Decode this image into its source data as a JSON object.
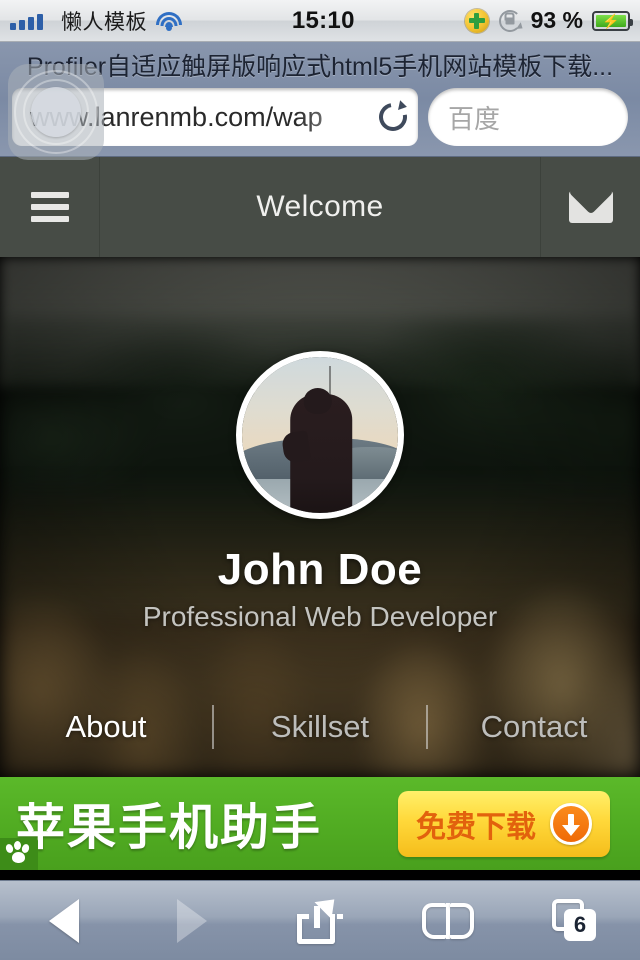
{
  "status_bar": {
    "carrier": "懒人模板",
    "signal_icon": "signal-bars-icon",
    "wifi_icon": "wifi-icon",
    "time": "15:10",
    "plus_icon": "green-plus-circle-icon",
    "rotation_lock_icon": "rotation-lock-icon",
    "battery_percent": "93 %",
    "battery_icon": "battery-charging-icon",
    "signal_bars_filled": 4,
    "signal_bars_total": 5
  },
  "assistive_touch": {
    "name": "assistive-touch-button"
  },
  "browser": {
    "page_title": "Profiler自适应触屏版响应式html5手机网站模板下载...",
    "url": "www.lanrenmb.com/wap",
    "reload_icon": "reload-icon",
    "search_placeholder": "百度"
  },
  "site_header": {
    "menu_icon": "hamburger-menu-icon",
    "title": "Welcome",
    "mail_icon": "envelope-icon"
  },
  "hero": {
    "avatar_alt": "profile-photo",
    "name": "John Doe",
    "tagline": "Professional Web Developer",
    "nav": [
      {
        "label": "About",
        "active": true
      },
      {
        "label": "Skillset",
        "active": false
      },
      {
        "label": "Contact",
        "active": false
      }
    ]
  },
  "ad": {
    "headline": "苹果手机助手",
    "button_label": "免费下载",
    "download_icon": "download-circle-icon",
    "provider_icon": "baidu-paw-icon",
    "bg_color": "#52ad23",
    "button_color": "#ffd83a",
    "button_text_color": "#e2620d"
  },
  "toolbar_bottom": {
    "back_icon": "back-arrow-icon",
    "forward_icon": "forward-arrow-icon",
    "share_icon": "share-icon",
    "bookmarks_icon": "bookmarks-book-icon",
    "tabs_icon": "tabs-icon",
    "tab_count": "6"
  }
}
